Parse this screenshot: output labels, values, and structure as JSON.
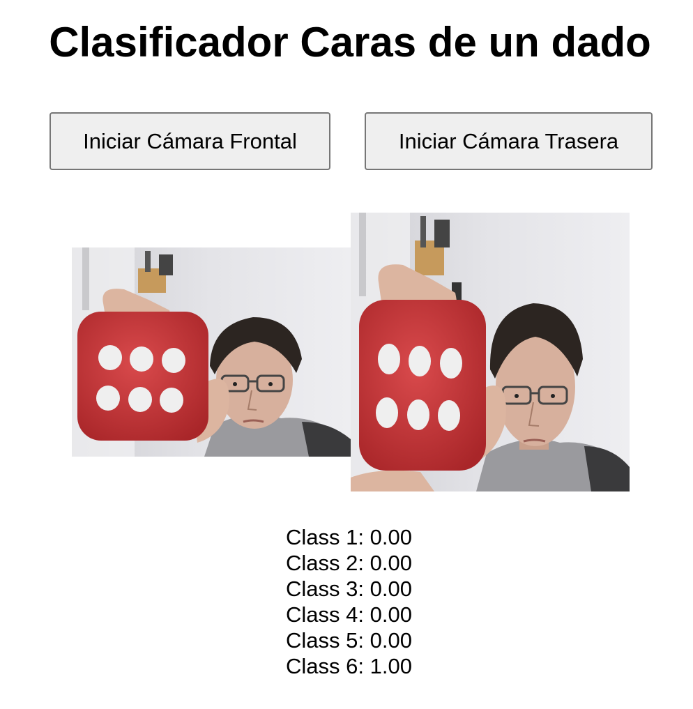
{
  "page": {
    "title": "Clasificador Caras de un dado"
  },
  "controls": {
    "front_camera_label": "Iniciar Cámara Frontal",
    "back_camera_label": "Iniciar Cámara Trasera"
  },
  "views": {
    "webcam_image": "live-camera-feed",
    "canvas_image": "captured-frame"
  },
  "predictions": [
    {
      "label": "Class 1",
      "value": "0.00"
    },
    {
      "label": "Class 2",
      "value": "0.00"
    },
    {
      "label": "Class 3",
      "value": "0.00"
    },
    {
      "label": "Class 4",
      "value": "0.00"
    },
    {
      "label": "Class 5",
      "value": "0.00"
    },
    {
      "label": "Class 6",
      "value": "1.00"
    }
  ],
  "colors": {
    "die_red": "#c8393c",
    "button_bg": "#efefef",
    "button_border": "#767676"
  }
}
